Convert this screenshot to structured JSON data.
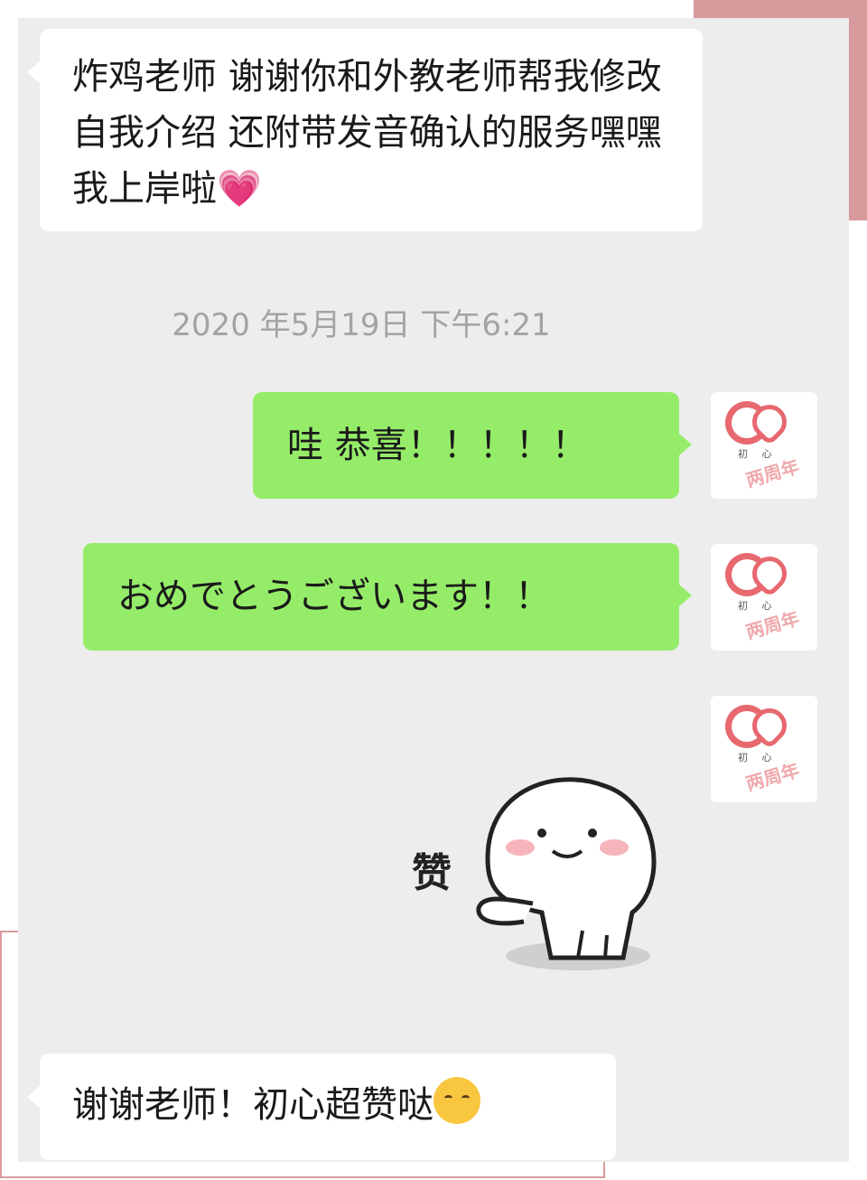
{
  "messages": [
    {
      "sender": "contact",
      "text": "炸鸡老师 谢谢你和外教老师帮我修改自我介绍 还附带发音确认的服务嘿嘿 我上岸啦",
      "emoji": "heart-icon"
    },
    {
      "sender": "self",
      "text": "哇 恭喜！！！！！"
    },
    {
      "sender": "self",
      "text": "おめでとうございます！！"
    },
    {
      "sender": "self",
      "sticker": "thumbs-up-sticker",
      "sticker_text": "赞"
    },
    {
      "sender": "contact",
      "text": "谢谢老师！初心超赞哒",
      "emoji": "smiling-face-with-hearts-icon"
    }
  ],
  "timestamp": "2020 年5月19日 下午6:21",
  "avatar": {
    "logo_text": "初 心",
    "badge_text": "两周年"
  },
  "colors": {
    "chat_bg": "#ededed",
    "outgoing_bubble": "#95ec69",
    "incoming_bubble": "#ffffff",
    "accent_pink": "#d99a9d",
    "brand_red": "#e7686f"
  }
}
